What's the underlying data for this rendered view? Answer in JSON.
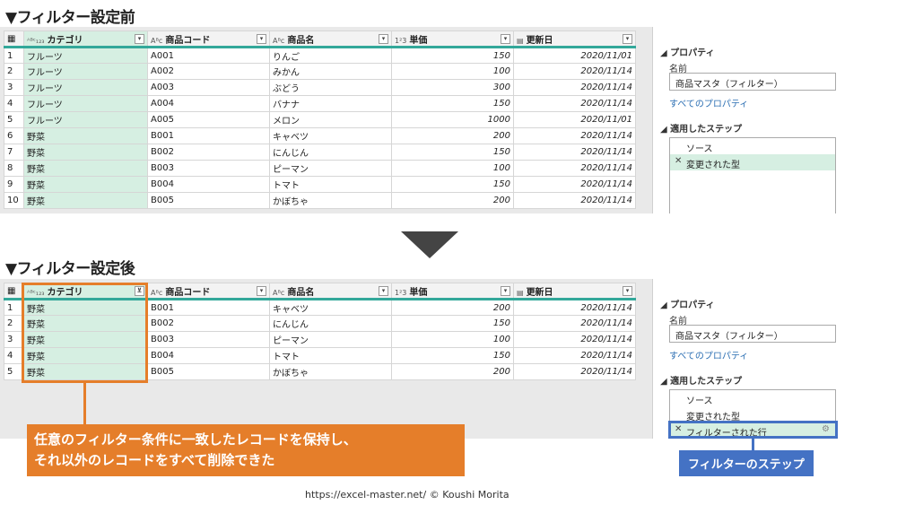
{
  "top": {
    "heading": "▼フィルター設定前",
    "columns": [
      {
        "type": "ABC/123",
        "label": "カテゴリ"
      },
      {
        "type": "ABC",
        "label": "商品コード"
      },
      {
        "type": "ABC",
        "label": "商品名"
      },
      {
        "type": "123",
        "label": "単価"
      },
      {
        "type": "date",
        "label": "更新日"
      }
    ],
    "rows": [
      {
        "n": "1",
        "cat": "フルーツ",
        "code": "A001",
        "name": "りんご",
        "price": "150",
        "date": "2020/11/01"
      },
      {
        "n": "2",
        "cat": "フルーツ",
        "code": "A002",
        "name": "みかん",
        "price": "100",
        "date": "2020/11/14"
      },
      {
        "n": "3",
        "cat": "フルーツ",
        "code": "A003",
        "name": "ぶどう",
        "price": "300",
        "date": "2020/11/14"
      },
      {
        "n": "4",
        "cat": "フルーツ",
        "code": "A004",
        "name": "バナナ",
        "price": "150",
        "date": "2020/11/14"
      },
      {
        "n": "5",
        "cat": "フルーツ",
        "code": "A005",
        "name": "メロン",
        "price": "1000",
        "date": "2020/11/01"
      },
      {
        "n": "6",
        "cat": "野菜",
        "code": "B001",
        "name": "キャベツ",
        "price": "200",
        "date": "2020/11/14"
      },
      {
        "n": "7",
        "cat": "野菜",
        "code": "B002",
        "name": "にんじん",
        "price": "150",
        "date": "2020/11/14"
      },
      {
        "n": "8",
        "cat": "野菜",
        "code": "B003",
        "name": "ピーマン",
        "price": "100",
        "date": "2020/11/14"
      },
      {
        "n": "9",
        "cat": "野菜",
        "code": "B004",
        "name": "トマト",
        "price": "150",
        "date": "2020/11/14"
      },
      {
        "n": "10",
        "cat": "野菜",
        "code": "B005",
        "name": "かぼちゃ",
        "price": "200",
        "date": "2020/11/14"
      }
    ],
    "side": {
      "properties": "プロパティ",
      "name_label": "名前",
      "name_value": "商品マスタ（フィルター）",
      "all_props": "すべてのプロパティ",
      "applied_steps": "適用したステップ",
      "steps": [
        "ソース",
        "変更された型"
      ]
    }
  },
  "bottom": {
    "heading": "▼フィルター設定後",
    "rows": [
      {
        "n": "1",
        "cat": "野菜",
        "code": "B001",
        "name": "キャベツ",
        "price": "200",
        "date": "2020/11/14"
      },
      {
        "n": "2",
        "cat": "野菜",
        "code": "B002",
        "name": "にんじん",
        "price": "150",
        "date": "2020/11/14"
      },
      {
        "n": "3",
        "cat": "野菜",
        "code": "B003",
        "name": "ピーマン",
        "price": "100",
        "date": "2020/11/14"
      },
      {
        "n": "4",
        "cat": "野菜",
        "code": "B004",
        "name": "トマト",
        "price": "150",
        "date": "2020/11/14"
      },
      {
        "n": "5",
        "cat": "野菜",
        "code": "B005",
        "name": "かぼちゃ",
        "price": "200",
        "date": "2020/11/14"
      }
    ],
    "side": {
      "steps": [
        "ソース",
        "変更された型",
        "フィルターされた行"
      ]
    }
  },
  "callout_main_line1": "任意のフィルター条件に一致したレコードを保持し、",
  "callout_main_line2": "それ以外のレコードをすべて削除できた",
  "callout_step": "フィルターのステップ",
  "credit": "https://excel-master.net/  © Koushi Morita",
  "colors": {
    "accent_orange": "#e57e2a",
    "accent_blue": "#4472c4",
    "teal": "#33a89a",
    "selected_green": "#d6efe2"
  }
}
